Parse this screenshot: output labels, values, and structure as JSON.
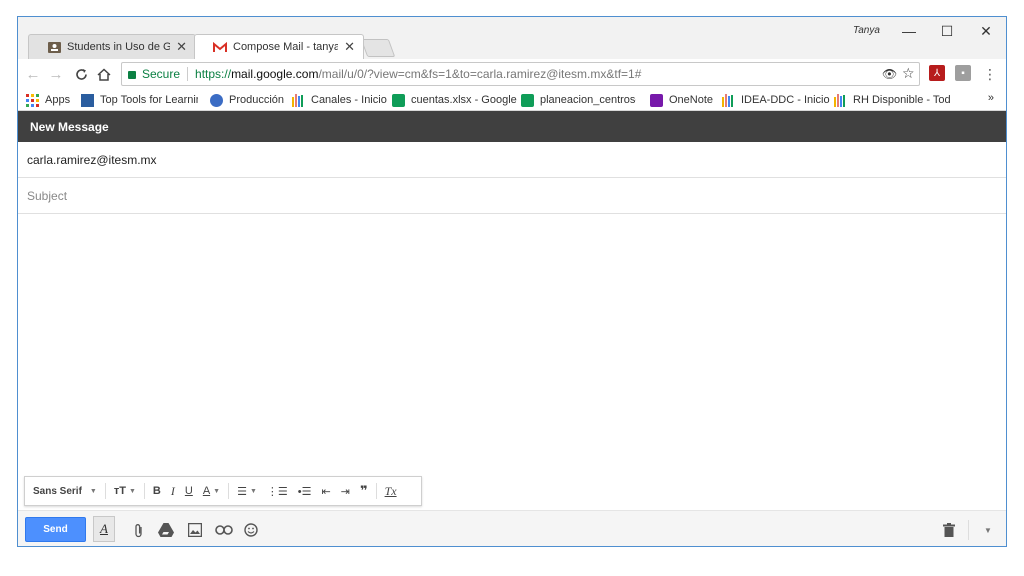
{
  "browser": {
    "profile_name": "Tanya",
    "tabs": [
      {
        "title": "Students in Uso de Goog",
        "close": "✕",
        "icon": "classroom-icon"
      },
      {
        "title": "Compose Mail - tanya.go",
        "close": "✕",
        "icon": "gmail-icon"
      }
    ],
    "window_controls": {
      "minimize": "—",
      "maximize": "☐",
      "close": "✕"
    },
    "address": {
      "secure_label": "Secure",
      "url_scheme": "https://",
      "url_host": "mail.google.com",
      "url_path": "/mail/u/0/?view=cm&fs=1&to=carla.ramirez@itesm.mx&tf=1#"
    },
    "bookmarks": [
      {
        "label": "Apps",
        "icon": "apps-icon"
      },
      {
        "label": "Top Tools for Learning",
        "icon": "bookmark-image-icon"
      },
      {
        "label": "Producción",
        "icon": "globe-icon"
      },
      {
        "label": "Canales - Inicio",
        "icon": "bars-icon"
      },
      {
        "label": "cuentas.xlsx - Google",
        "icon": "sheets-icon"
      },
      {
        "label": "planeacion_centroser",
        "icon": "sheets-icon"
      },
      {
        "label": "OneNote",
        "icon": "onenote-icon"
      },
      {
        "label": "IDEA-DDC - Inicio",
        "icon": "bars-icon"
      },
      {
        "label": "RH Disponible - Todo",
        "icon": "bars-icon"
      }
    ],
    "bookmarks_more": "»"
  },
  "compose": {
    "header_title": "New Message",
    "to_value": "carla.ramirez@itesm.mx",
    "subject_placeholder": "Subject",
    "format_bar": {
      "font_family": "Sans Serif",
      "size_icon": "text-size-icon",
      "bold": "B",
      "italic": "I",
      "underline": "U",
      "text_color": "A"
    },
    "send_label": "Send"
  },
  "colors": {
    "header_bg": "#404040",
    "send_bg": "#4d90fe",
    "secure_green": "#0b8043",
    "window_border": "#4f8fd0"
  }
}
